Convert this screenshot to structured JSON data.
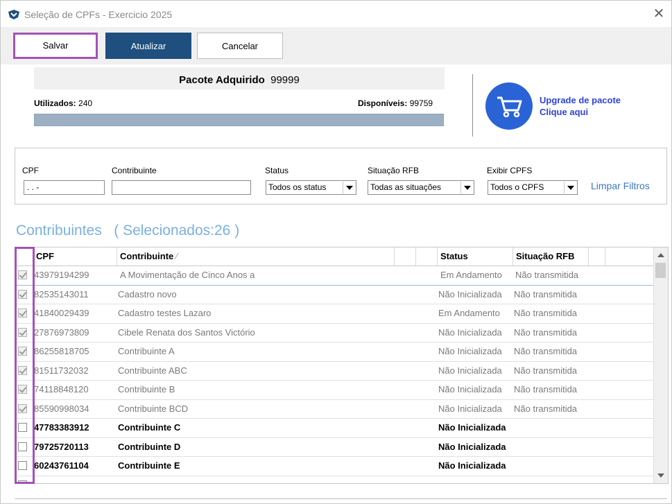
{
  "window": {
    "title": "Seleção de CPFs - Exercicio 2025",
    "close_glyph": "✕"
  },
  "toolbar": {
    "save_label": "Salvar",
    "update_label": "Atualizar",
    "cancel_label": "Cancelar"
  },
  "package": {
    "title": "Pacote Adquirido",
    "total": "99999",
    "used_label": "Utilizados:",
    "used_value": "240",
    "available_label": "Disponíveis:",
    "available_value": "99759",
    "usage_fraction": 0.0024
  },
  "upgrade": {
    "line1": "Upgrade de pacote",
    "line2": "Clique aqui",
    "icon": "shopping-cart-icon"
  },
  "filters": {
    "cpf_label": "CPF",
    "cpf_value": " .   .   -",
    "contribuinte_label": "Contribuinte",
    "contribuinte_value": "",
    "status_label": "Status",
    "status_value": "Todos os status",
    "situacao_label": "Situação RFB",
    "situacao_value": "Todas as situações",
    "exibir_label": "Exibir CPFS",
    "exibir_value": "Todos o CPFS",
    "clear_label": "Limpar Filtros"
  },
  "section": {
    "title": "Contribuintes",
    "selected": "( Selecionados:26 )"
  },
  "grid": {
    "headers": {
      "cpf": "CPF",
      "contribuinte": "Contribuinte",
      "status": "Status",
      "situacao": "Situação RFB"
    },
    "rows": [
      {
        "cpf": "43979194299",
        "nome": "A Movimentação de Cinco Anos a",
        "status": "Em Andamento",
        "situacao": "Não transmitida",
        "checked": true
      },
      {
        "cpf": "82535143011",
        "nome": "Cadastro novo",
        "status": "Não Inicializada",
        "situacao": "Não transmitida",
        "checked": true
      },
      {
        "cpf": "41840029439",
        "nome": "Cadastro testes Lazaro",
        "status": "Em Andamento",
        "situacao": "Não transmitida",
        "checked": true
      },
      {
        "cpf": "27876973809",
        "nome": "Cibele Renata dos Santos Victório",
        "status": "Não Inicializada",
        "situacao": "Não transmitida",
        "checked": true
      },
      {
        "cpf": "86255818705",
        "nome": "Contribuinte A",
        "status": "Não Inicializada",
        "situacao": "Não transmitida",
        "checked": true
      },
      {
        "cpf": "81511732032",
        "nome": "Contribuinte ABC",
        "status": "Não Inicializada",
        "situacao": "Não transmitida",
        "checked": true
      },
      {
        "cpf": "74118848120",
        "nome": "Contribuinte B",
        "status": "Não Inicializada",
        "situacao": "Não transmitida",
        "checked": true
      },
      {
        "cpf": "85590998034",
        "nome": "Contribuinte BCD",
        "status": "Não Inicializada",
        "situacao": "Não transmitida",
        "checked": true
      },
      {
        "cpf": "47783383912",
        "nome": "Contribuinte C",
        "status": "Não Inicializada",
        "situacao": "",
        "checked": false
      },
      {
        "cpf": "79725720113",
        "nome": "Contribuinte D",
        "status": "Não Inicializada",
        "situacao": "",
        "checked": false
      },
      {
        "cpf": "60243761104",
        "nome": "Contribuinte E",
        "status": "Não Inicializada",
        "situacao": "",
        "checked": false
      },
      {
        "cpf": "",
        "nome": "",
        "status": "",
        "situacao": "",
        "checked": false
      }
    ]
  },
  "colors": {
    "accent_highlight": "#a352b7",
    "primary_button": "#1e4f7e",
    "link": "#3a78c4",
    "cart": "#2a63d6",
    "section_title": "#7ab0e0"
  }
}
